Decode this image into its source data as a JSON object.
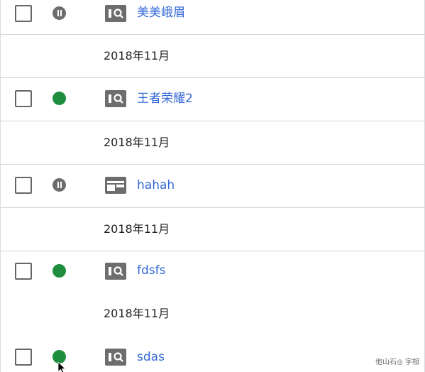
{
  "items": [
    {
      "name": "美美峨眉",
      "status": "paused",
      "type": "search-card",
      "date": "2018年11月"
    },
    {
      "name": "王者荣耀2",
      "status": "active",
      "type": "search-card",
      "date": "2018年11月"
    },
    {
      "name": "hahah",
      "status": "paused",
      "type": "display-layout",
      "date": "2018年11月"
    },
    {
      "name": "fdsfs",
      "status": "active",
      "type": "search-card",
      "date": "2018年11月"
    },
    {
      "name": "sdas",
      "status": "active",
      "type": "search-card"
    }
  ],
  "colors": {
    "active": "#1e8e3e",
    "paused": "#6d6d6d",
    "link": "#3367d6"
  },
  "icons": {
    "paused": "pause-circle-icon",
    "active": "active-dot-icon",
    "search-card": "search-card-icon",
    "display-layout": "display-layout-icon"
  },
  "watermark": "他山石◎ 字相"
}
